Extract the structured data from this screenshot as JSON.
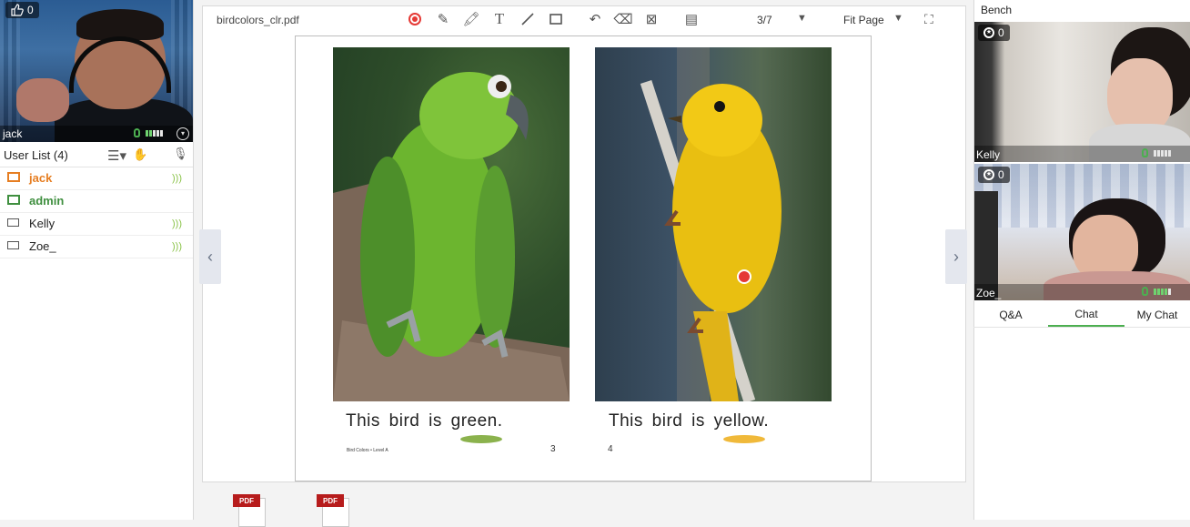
{
  "teacher_video": {
    "likes": "0",
    "name": "jack"
  },
  "user_list": {
    "title": "User List (4)",
    "users": [
      {
        "name": "jack",
        "color": "#e67e22"
      },
      {
        "name": "admin",
        "color": "#3f8f3f"
      },
      {
        "name": "Kelly",
        "color": "#222222"
      },
      {
        "name": "Zoe_",
        "color": "#222222"
      }
    ]
  },
  "document": {
    "filename": "birdcolors_clr.pdf",
    "page_indicator": "3/7",
    "zoom": "Fit Page",
    "captions": [
      "This bird is green.",
      "This bird is yellow."
    ],
    "footer_text": "Bird Colors • Level A",
    "page_numbers": [
      "3",
      "4"
    ]
  },
  "attachments": [
    {
      "label": "PDF"
    },
    {
      "label": "PDF"
    }
  ],
  "bench": {
    "title": "Bench",
    "students": [
      {
        "name": "Kelly",
        "stars": "0"
      },
      {
        "name": "Zoe_",
        "stars": "0"
      }
    ]
  },
  "tabs": {
    "items": [
      "Q&A",
      "Chat",
      "My Chat"
    ],
    "active": "Chat"
  },
  "colors": {
    "accent": "#4caf50",
    "annotation_red": "#e53935",
    "tab_active": "#4caf50"
  }
}
